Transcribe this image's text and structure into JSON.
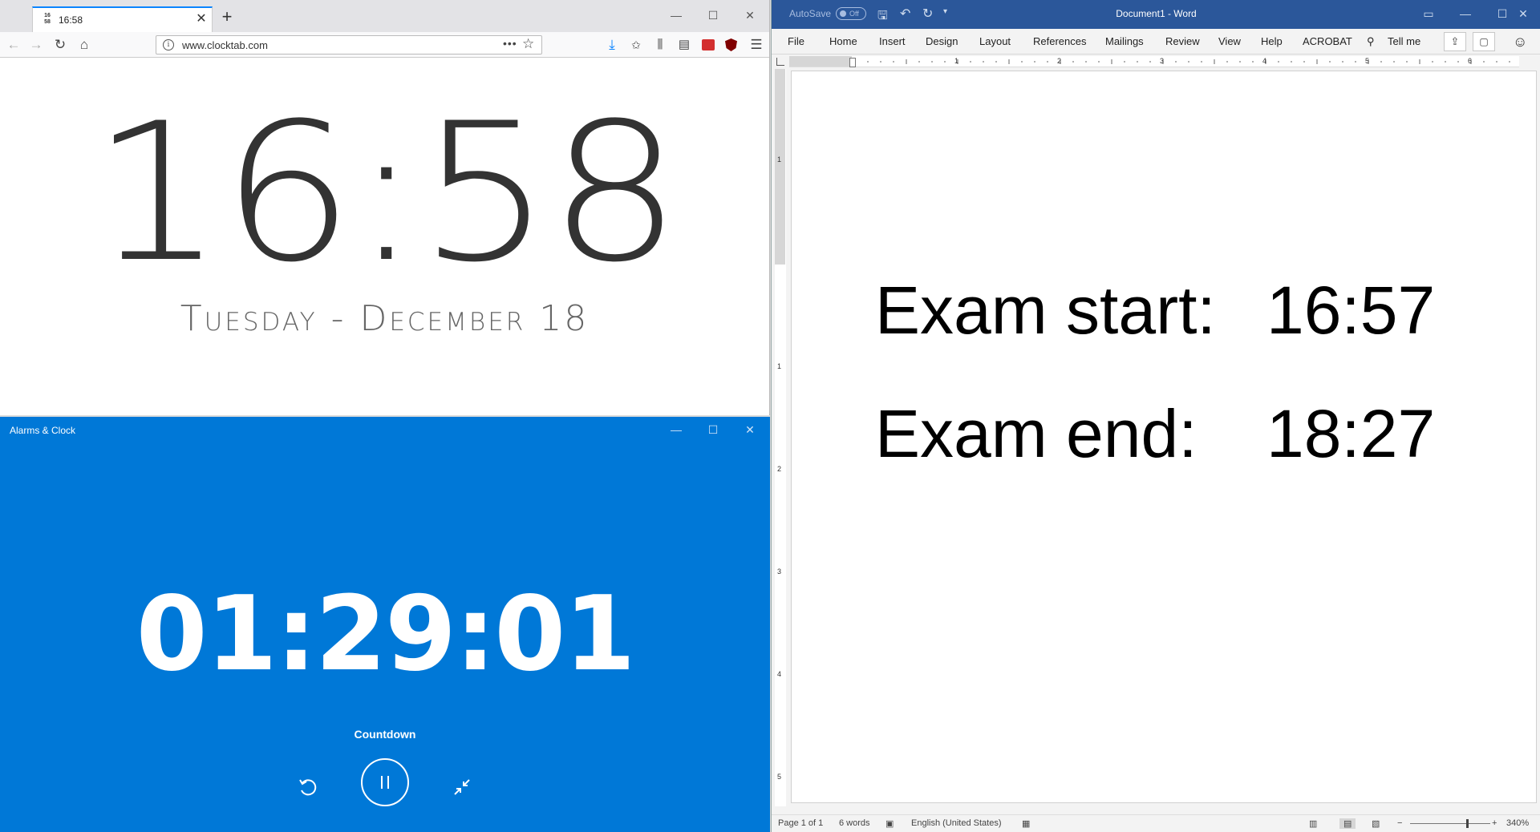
{
  "firefox": {
    "tab_title": "16:58",
    "favicon_line1": "16",
    "favicon_line2": "58",
    "close_tab": "✕",
    "new_tab": "+",
    "url": "www.clocktab.com",
    "url_actions": "•••",
    "time": "16:58",
    "date": "Tuesday - December 18",
    "accent": "#0a84ff"
  },
  "alarms": {
    "window_title": "Alarms & Clock",
    "countdown": "01:29:01",
    "label": "Countdown",
    "background": "#0078d7"
  },
  "word": {
    "autosave_label": "AutoSave",
    "autosave_state": "Off",
    "title": "Document1 - Word",
    "ribbon_tabs": [
      "File",
      "Home",
      "Insert",
      "Design",
      "Layout",
      "References",
      "Mailings",
      "Review",
      "View",
      "Help",
      "ACROBAT"
    ],
    "tell_me": "Tell me",
    "ruler_numbers": [
      "1",
      "2",
      "3",
      "4",
      "5",
      "6"
    ],
    "vruler_numbers": [
      "1",
      "1",
      "2",
      "3",
      "4",
      "5"
    ],
    "lines": [
      {
        "label": "Exam start:",
        "value": "16:57"
      },
      {
        "label": "Exam end:",
        "value": "18:27"
      }
    ],
    "status": {
      "page": "Page 1 of 1",
      "words": "6 words",
      "language": "English (United States)",
      "zoom": "340%"
    },
    "titlebar_color": "#2b579a"
  }
}
